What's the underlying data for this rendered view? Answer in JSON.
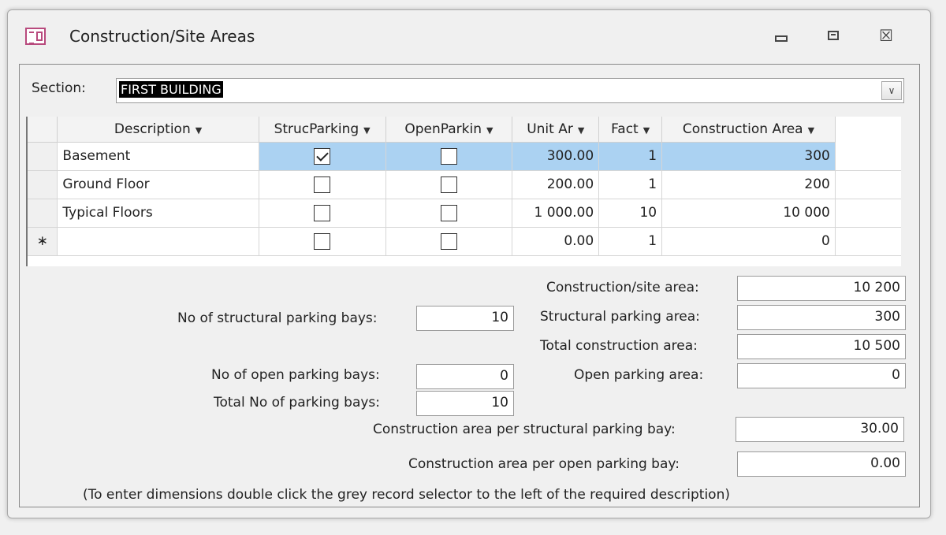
{
  "window": {
    "title": "Construction/Site Areas",
    "close_glyph": "☒"
  },
  "section": {
    "label": "Section:",
    "value": "FIRST BUILDING"
  },
  "grid": {
    "headers": [
      "Description",
      "StrucParking",
      "OpenParkin",
      "Unit Ar",
      "Fact",
      "Construction Area"
    ],
    "rows": [
      {
        "description": "Basement",
        "struc_parking": true,
        "open_parking": false,
        "unit_area": "300.00",
        "factor": "1",
        "construction_area": "300"
      },
      {
        "description": "Ground Floor",
        "struc_parking": false,
        "open_parking": false,
        "unit_area": "200.00",
        "factor": "1",
        "construction_area": "200"
      },
      {
        "description": "Typical Floors",
        "struc_parking": false,
        "open_parking": false,
        "unit_area": "1 000.00",
        "factor": "10",
        "construction_area": "10 000"
      }
    ],
    "new_row": {
      "marker": "∗",
      "struc_parking": false,
      "open_parking": false,
      "unit_area": "0.00",
      "factor": "1",
      "construction_area": "0"
    }
  },
  "summary": {
    "construction_site_area_label": "Construction/site area:",
    "construction_site_area": "10 200",
    "struc_bays_label": "No of structural parking bays:",
    "struc_bays": "10",
    "struc_parking_area_label": "Structural parking area:",
    "struc_parking_area": "300",
    "total_construction_area_label": "Total construction area:",
    "total_construction_area": "10 500",
    "open_bays_label": "No of open parking bays:",
    "open_bays": "0",
    "open_parking_area_label": "Open parking area:",
    "open_parking_area": "0",
    "total_bays_label": "Total No of parking bays:",
    "total_bays": "10",
    "per_struc_bay_label": "Construction area per structural parking bay:",
    "per_struc_bay": "30.00",
    "per_open_bay_label": "Construction area per open parking bay:",
    "per_open_bay": "0.00"
  },
  "note": "(To enter dimensions double click the grey record selector to the left of the required description)"
}
